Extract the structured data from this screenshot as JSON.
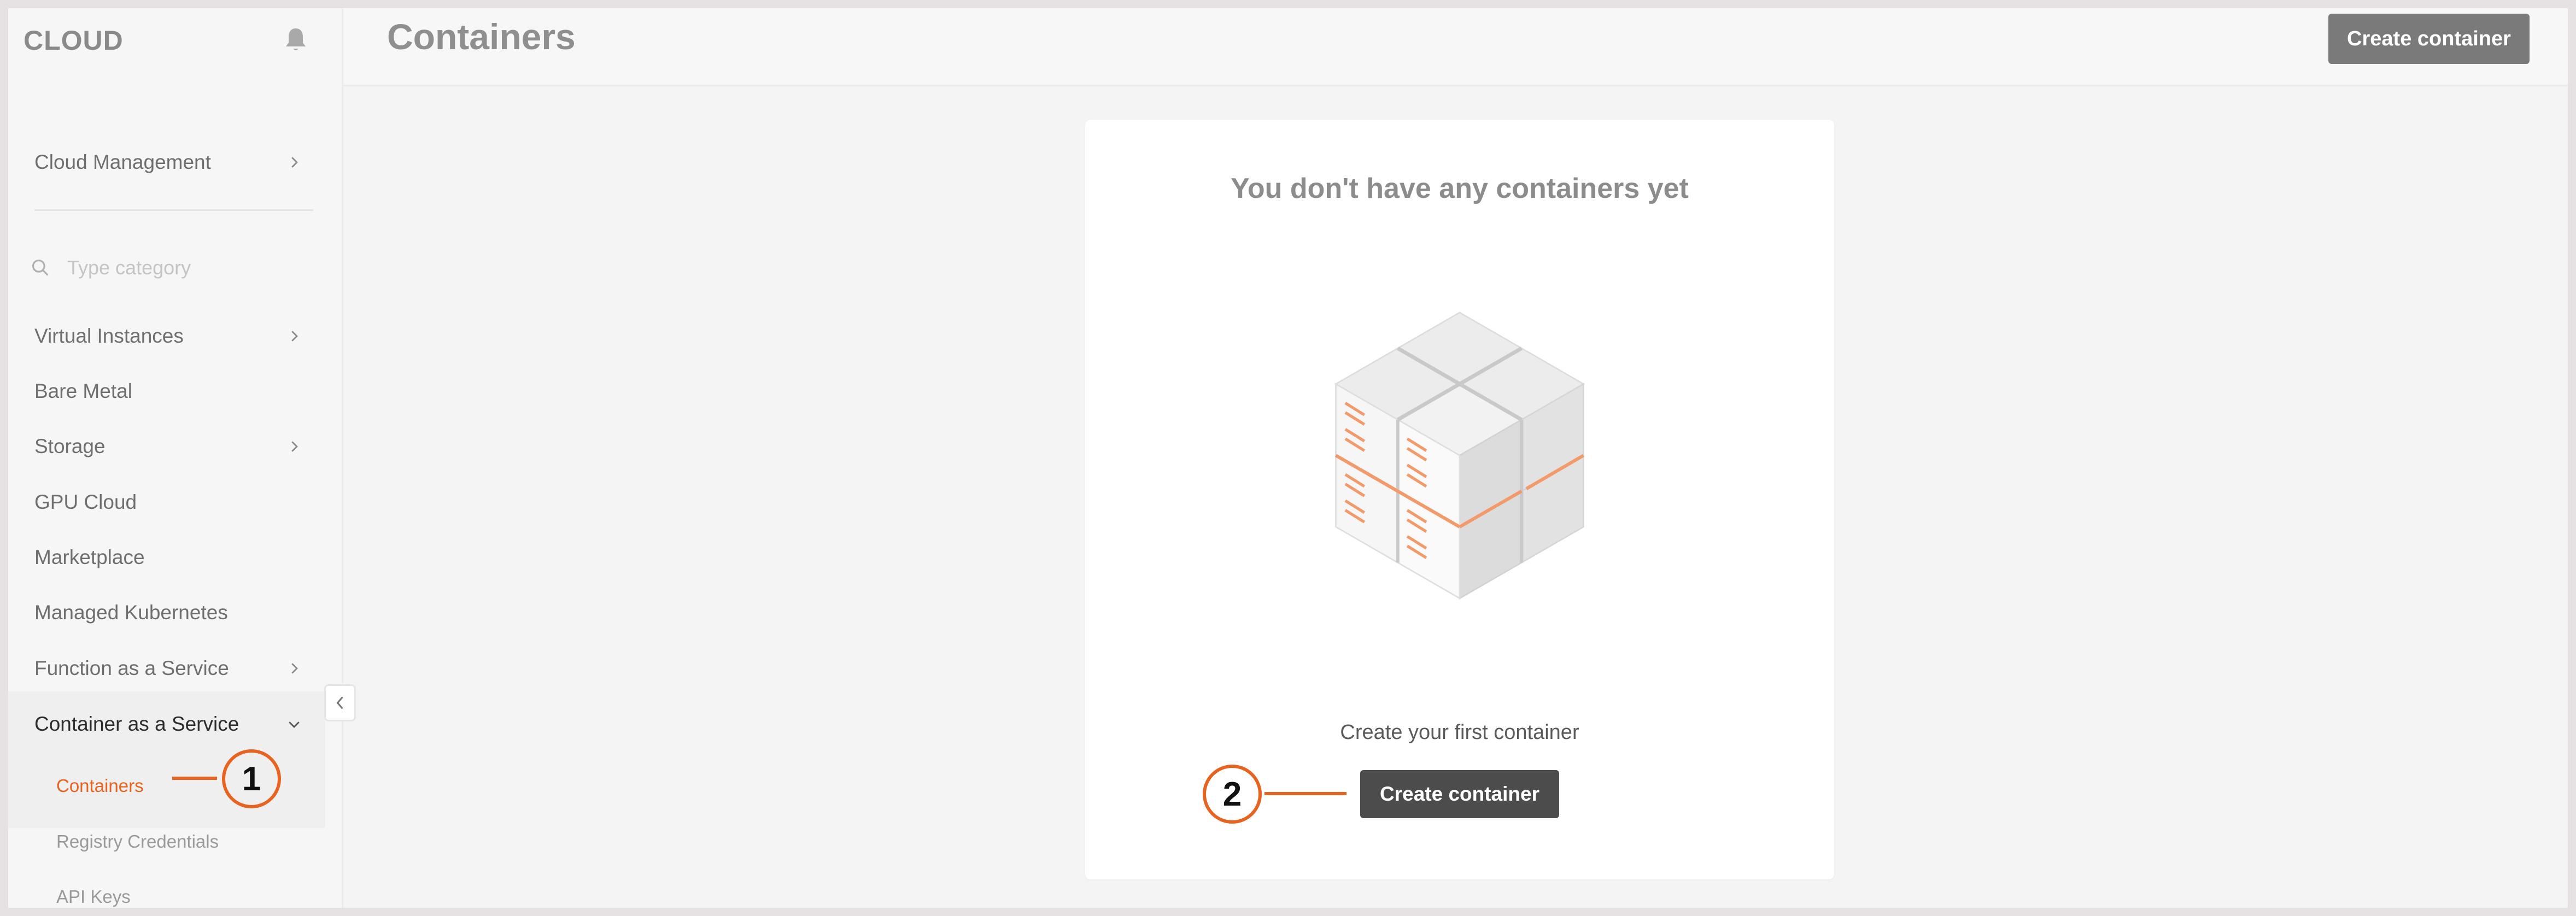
{
  "app": {
    "brand": "CLOUD"
  },
  "header": {
    "title": "Containers",
    "create_button": "Create container"
  },
  "sidebar": {
    "top_item": "Cloud Management",
    "search_placeholder": "Type category",
    "items": [
      {
        "label": "Virtual Instances",
        "has_children": true
      },
      {
        "label": "Bare Metal",
        "has_children": false
      },
      {
        "label": "Storage",
        "has_children": true
      },
      {
        "label": "GPU Cloud",
        "has_children": false
      },
      {
        "label": "Marketplace",
        "has_children": false
      },
      {
        "label": "Managed Kubernetes",
        "has_children": false
      },
      {
        "label": "Function as a Service",
        "has_children": true
      },
      {
        "label": "Container as a Service",
        "has_children": true,
        "expanded": true
      }
    ],
    "sub_items": [
      {
        "label": "Containers",
        "active": true
      },
      {
        "label": "Registry Credentials",
        "active": false
      },
      {
        "label": "API Keys",
        "active": false
      }
    ]
  },
  "main": {
    "empty_title": "You don't have any containers yet",
    "empty_subtitle": "Create your first container",
    "create_button": "Create container"
  },
  "annotations": {
    "callout_1": "1",
    "callout_2": "2"
  },
  "colors": {
    "accent": "#e8631f",
    "button": "#4c4c4c",
    "button_top": "#7a7a7a",
    "sidebar_bg": "#f6f6f6"
  },
  "icons": [
    "bell-icon",
    "chevron-right-icon",
    "chevron-down-icon",
    "search-icon",
    "chevron-left-icon",
    "containers-cube-illustration"
  ]
}
